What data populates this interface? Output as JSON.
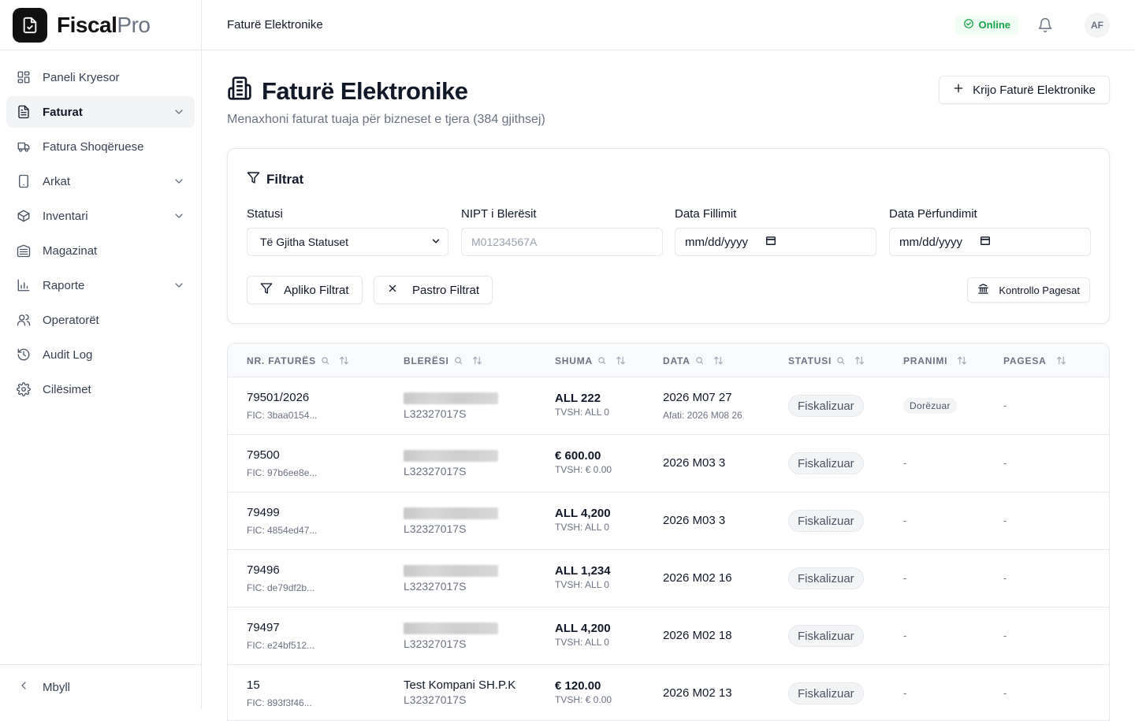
{
  "brand": {
    "name_bold": "Fiscal",
    "name_light": "Pro"
  },
  "sidebar": {
    "items": [
      {
        "label": "Paneli Kryesor",
        "icon": "dashboard-icon",
        "active": false,
        "chevron": false
      },
      {
        "label": "Faturat",
        "icon": "invoice-icon",
        "active": true,
        "chevron": true
      },
      {
        "label": "Fatura Shoqëruese",
        "icon": "truck-icon",
        "active": false,
        "chevron": false
      },
      {
        "label": "Arkat",
        "icon": "tablet-icon",
        "active": false,
        "chevron": true
      },
      {
        "label": "Inventari",
        "icon": "box-icon",
        "active": false,
        "chevron": true
      },
      {
        "label": "Magazinat",
        "icon": "warehouse-icon",
        "active": false,
        "chevron": false
      },
      {
        "label": "Raporte",
        "icon": "bar-chart-icon",
        "active": false,
        "chevron": true
      },
      {
        "label": "Operatorët",
        "icon": "users-icon",
        "active": false,
        "chevron": false
      },
      {
        "label": "Audit Log",
        "icon": "history-icon",
        "active": false,
        "chevron": false
      },
      {
        "label": "Cilësimet",
        "icon": "settings-icon",
        "active": false,
        "chevron": false
      }
    ],
    "collapse_label": "Mbyll"
  },
  "topbar": {
    "title": "Faturë Elektronike",
    "status": "Online",
    "avatar": "AF"
  },
  "page": {
    "title": "Faturë Elektronike",
    "subtitle": "Menaxhoni faturat tuaja për bizneset e tjera (384 gjithsej)",
    "create_label": "Krijo Faturë Elektronike"
  },
  "filters": {
    "title": "Filtrat",
    "status_label": "Statusi",
    "status_value": "Të Gjitha Statuset",
    "nipt_label": "NIPT i Blerësit",
    "nipt_placeholder": "M01234567A",
    "start_label": "Data Fillimit",
    "start_placeholder": "mm/dd/yyyy",
    "end_label": "Data Përfundimit",
    "end_placeholder": "mm/dd/yyyy",
    "apply_label": "Apliko Filtrat",
    "clear_label": "Pastro Filtrat",
    "check_label": "Kontrollo Pagesat"
  },
  "table": {
    "columns": [
      "NR. FATURËS",
      "BLERËSI",
      "SHUMA",
      "DATA",
      "STATUSI",
      "PRANIMI",
      "PAGESA"
    ],
    "rows": [
      {
        "number": "79501/2026",
        "fic": "FIC: 3baa0154...",
        "buyer_name": "",
        "buyer_redacted": true,
        "nipt": "L32327017S",
        "amount": "ALL 222",
        "vat": "TVSH: ALL 0",
        "date": "2026 M07 27",
        "due": "Afati: 2026 M08 26",
        "status": "Fiskalizuar",
        "acceptance": "Dorëzuar",
        "payment": "-"
      },
      {
        "number": "79500",
        "fic": "FIC: 97b6ee8e...",
        "buyer_name": "",
        "buyer_redacted": true,
        "nipt": "L32327017S",
        "amount": "€ 600.00",
        "vat": "TVSH: € 0.00",
        "date": "2026 M03 3",
        "due": "",
        "status": "Fiskalizuar",
        "acceptance": "-",
        "payment": "-"
      },
      {
        "number": "79499",
        "fic": "FIC: 4854ed47...",
        "buyer_name": "",
        "buyer_redacted": true,
        "nipt": "L32327017S",
        "amount": "ALL 4,200",
        "vat": "TVSH: ALL 0",
        "date": "2026 M03 3",
        "due": "",
        "status": "Fiskalizuar",
        "acceptance": "-",
        "payment": "-"
      },
      {
        "number": "79496",
        "fic": "FIC: de79df2b...",
        "buyer_name": "",
        "buyer_redacted": true,
        "nipt": "L32327017S",
        "amount": "ALL 1,234",
        "vat": "TVSH: ALL 0",
        "date": "2026 M02 16",
        "due": "",
        "status": "Fiskalizuar",
        "acceptance": "-",
        "payment": "-"
      },
      {
        "number": "79497",
        "fic": "FIC: e24bf512...",
        "buyer_name": "",
        "buyer_redacted": true,
        "nipt": "L32327017S",
        "amount": "ALL 4,200",
        "vat": "TVSH: ALL 0",
        "date": "2026 M02 18",
        "due": "",
        "status": "Fiskalizuar",
        "acceptance": "-",
        "payment": "-"
      },
      {
        "number": "15",
        "fic": "FIC: 893f3f46...",
        "buyer_name": "Test Kompani SH.P.K",
        "buyer_redacted": false,
        "nipt": "L32327017S",
        "amount": "€ 120.00",
        "vat": "TVSH: € 0.00",
        "date": "2026 M02 13",
        "due": "",
        "status": "Fiskalizuar",
        "acceptance": "-",
        "payment": "-"
      }
    ]
  },
  "colors": {
    "online": "#16a34a",
    "brand_bg": "#111111",
    "border": "#e5e7eb"
  }
}
